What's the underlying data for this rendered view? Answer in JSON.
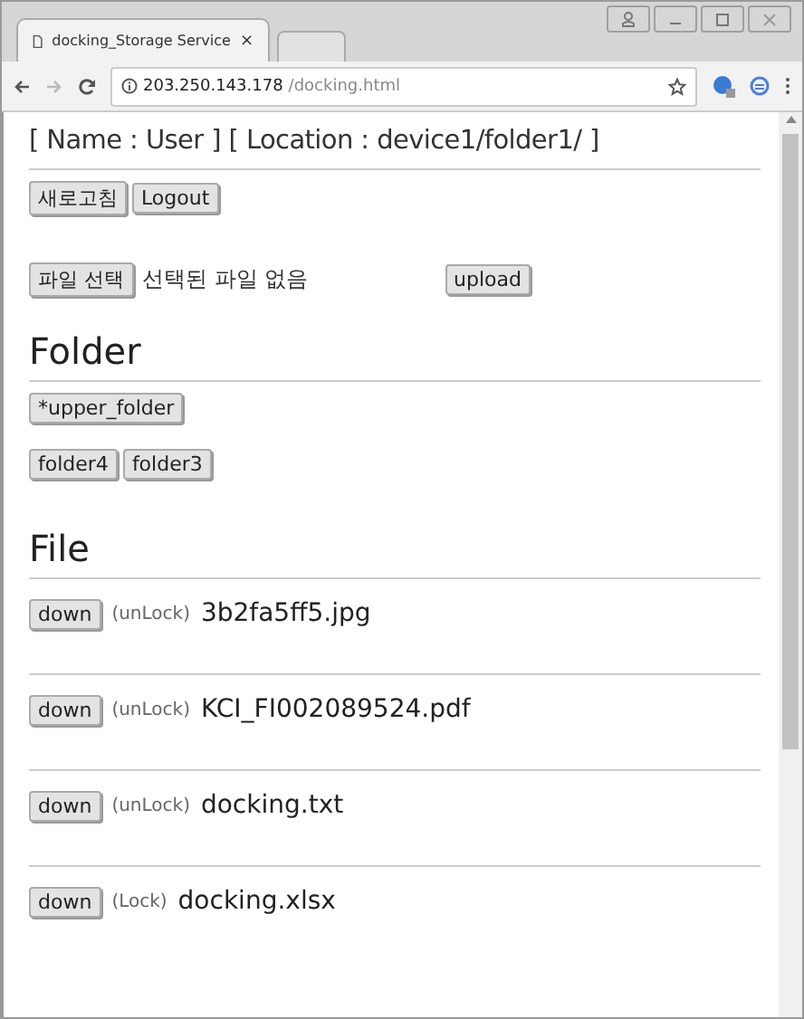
{
  "browser": {
    "tab_title": "docking_Storage Service",
    "tab_close": "×",
    "url_host": "203.250.143.178",
    "url_path": "/docking.html"
  },
  "header": {
    "info": "[ Name : User ] [ Location : device1/folder1/ ]",
    "buttons": [
      "새로고침",
      "Logout"
    ]
  },
  "upload": {
    "choose_button": "파일 선택",
    "status": "선택된 파일 없음",
    "upload_button": "upload"
  },
  "folder_section": {
    "heading": "Folder",
    "upper": "*upper_folder",
    "folders": [
      "folder4",
      "folder3"
    ]
  },
  "file_section": {
    "heading": "File",
    "files": [
      {
        "button": "down",
        "lock": "(unLock)",
        "name": "3b2fa5ff5.jpg"
      },
      {
        "button": "down",
        "lock": "(unLock)",
        "name": "KCI_FI002089524.pdf"
      },
      {
        "button": "down",
        "lock": "(unLock)",
        "name": "docking.txt"
      },
      {
        "button": "down",
        "lock": "(Lock)",
        "name": "docking.xlsx"
      }
    ]
  }
}
